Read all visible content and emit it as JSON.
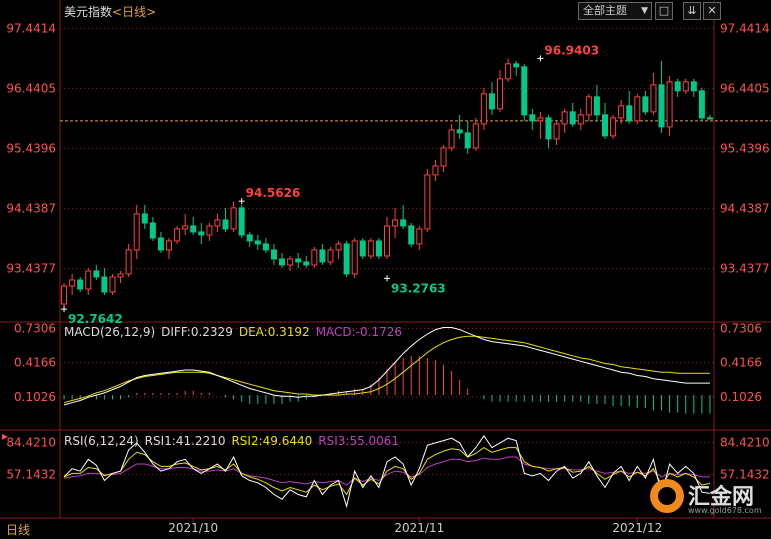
{
  "header": {
    "title": "美元指数",
    "timeframe": "<日线>",
    "dropdown_label": "全部主题",
    "btn_full": "□",
    "btn_down": "⇊",
    "btn_close": "✕"
  },
  "period_label": "日线",
  "logo": {
    "name": "汇金网",
    "url": "www.gold678.com"
  },
  "colors": {
    "up": "#ff4040",
    "down": "#00c98a",
    "grid": "#8b1a1a",
    "ref": "#e8a33a",
    "dif": "#ffffff",
    "dea": "#e8e000",
    "macd": "#c040c0",
    "axis_text": "#ff5050"
  },
  "chart_data": [
    {
      "type": "candlestick",
      "title": "美元指数",
      "y_ticks": [
        97.4414,
        96.4405,
        95.4396,
        94.4387,
        93.4377
      ],
      "ylim": [
        92.55,
        97.58
      ],
      "reference_price": 95.9,
      "x_ticks": [
        {
          "label": "2021/10",
          "index": 16
        },
        {
          "label": "2021/11",
          "index": 44
        },
        {
          "label": "2021/12",
          "index": 71
        }
      ],
      "annotations": [
        {
          "text": "96.9403",
          "index": 59,
          "value": 96.9403,
          "color": "up"
        },
        {
          "text": "94.5626",
          "index": 22,
          "value": 94.5626,
          "color": "up"
        },
        {
          "text": "93.2763",
          "index": 40,
          "value": 93.2763,
          "color": "down"
        },
        {
          "text": "92.7642",
          "index": 0,
          "value": 92.7642,
          "color": "down"
        }
      ],
      "ohlc": [
        [
          92.85,
          93.2,
          92.76,
          93.15
        ],
        [
          93.15,
          93.35,
          93.0,
          93.25
        ],
        [
          93.25,
          93.3,
          93.05,
          93.1
        ],
        [
          93.1,
          93.45,
          93.0,
          93.4
        ],
        [
          93.4,
          93.5,
          93.25,
          93.3
        ],
        [
          93.3,
          93.45,
          93.0,
          93.05
        ],
        [
          93.05,
          93.35,
          93.0,
          93.3
        ],
        [
          93.3,
          93.4,
          93.2,
          93.35
        ],
        [
          93.35,
          93.85,
          93.3,
          93.75
        ],
        [
          93.75,
          94.5,
          93.6,
          94.35
        ],
        [
          94.35,
          94.5,
          94.1,
          94.2
        ],
        [
          94.2,
          94.3,
          93.9,
          93.95
        ],
        [
          93.95,
          94.05,
          93.7,
          93.75
        ],
        [
          93.75,
          93.95,
          93.6,
          93.9
        ],
        [
          93.9,
          94.15,
          93.85,
          94.1
        ],
        [
          94.1,
          94.35,
          94.0,
          94.15
        ],
        [
          94.15,
          94.3,
          94.0,
          94.05
        ],
        [
          94.05,
          94.2,
          93.85,
          94.0
        ],
        [
          94.0,
          94.2,
          93.9,
          94.15
        ],
        [
          94.15,
          94.35,
          94.05,
          94.25
        ],
        [
          94.25,
          94.45,
          94.05,
          94.1
        ],
        [
          94.1,
          94.56,
          94.05,
          94.45
        ],
        [
          94.45,
          94.5,
          93.95,
          94.0
        ],
        [
          94.0,
          94.05,
          93.8,
          93.9
        ],
        [
          93.9,
          94.0,
          93.75,
          93.85
        ],
        [
          93.85,
          93.95,
          93.7,
          93.75
        ],
        [
          93.75,
          93.85,
          93.5,
          93.6
        ],
        [
          93.6,
          93.7,
          93.45,
          93.5
        ],
        [
          93.5,
          93.65,
          93.4,
          93.6
        ],
        [
          93.6,
          93.7,
          93.45,
          93.55
        ],
        [
          93.55,
          93.65,
          93.45,
          93.5
        ],
        [
          93.5,
          93.8,
          93.45,
          93.75
        ],
        [
          93.75,
          93.85,
          93.5,
          93.55
        ],
        [
          93.55,
          93.8,
          93.5,
          93.75
        ],
        [
          93.75,
          93.9,
          93.6,
          93.85
        ],
        [
          93.85,
          93.9,
          93.3,
          93.35
        ],
        [
          93.35,
          93.95,
          93.28,
          93.9
        ],
        [
          93.9,
          93.95,
          93.6,
          93.65
        ],
        [
          93.65,
          93.95,
          93.6,
          93.9
        ],
        [
          93.9,
          93.95,
          93.6,
          93.65
        ],
        [
          93.65,
          94.3,
          93.6,
          94.15
        ],
        [
          94.15,
          94.45,
          93.95,
          94.25
        ],
        [
          94.25,
          94.5,
          94.1,
          94.15
        ],
        [
          94.15,
          94.2,
          93.8,
          93.85
        ],
        [
          93.85,
          94.15,
          93.75,
          94.1
        ],
        [
          94.1,
          95.1,
          94.05,
          95.0
        ],
        [
          95.0,
          95.25,
          94.9,
          95.15
        ],
        [
          95.15,
          95.5,
          95.05,
          95.45
        ],
        [
          95.45,
          95.85,
          95.4,
          95.75
        ],
        [
          95.75,
          96.0,
          95.6,
          95.7
        ],
        [
          95.7,
          95.9,
          95.35,
          95.45
        ],
        [
          95.45,
          95.95,
          95.4,
          95.85
        ],
        [
          95.85,
          96.45,
          95.75,
          96.35
        ],
        [
          96.35,
          96.55,
          96.0,
          96.1
        ],
        [
          96.1,
          96.75,
          96.05,
          96.6
        ],
        [
          96.6,
          96.94,
          96.55,
          96.85
        ],
        [
          96.85,
          96.9,
          96.65,
          96.8
        ],
        [
          96.8,
          96.85,
          95.9,
          96.0
        ],
        [
          96.0,
          96.1,
          95.75,
          95.9
        ],
        [
          95.9,
          96.05,
          95.6,
          95.95
        ],
        [
          95.95,
          96.0,
          95.45,
          95.6
        ],
        [
          95.6,
          95.9,
          95.5,
          95.85
        ],
        [
          95.85,
          96.1,
          95.7,
          96.05
        ],
        [
          96.05,
          96.2,
          95.8,
          95.85
        ],
        [
          95.85,
          96.1,
          95.75,
          96.0
        ],
        [
          96.0,
          96.35,
          95.9,
          96.3
        ],
        [
          96.3,
          96.5,
          95.9,
          96.0
        ],
        [
          96.0,
          96.2,
          95.6,
          95.65
        ],
        [
          95.65,
          96.0,
          95.6,
          95.95
        ],
        [
          95.95,
          96.25,
          95.85,
          96.15
        ],
        [
          96.15,
          96.4,
          95.85,
          95.9
        ],
        [
          95.9,
          96.35,
          95.85,
          96.3
        ],
        [
          96.3,
          96.4,
          96.0,
          96.05
        ],
        [
          96.05,
          96.7,
          96.0,
          96.5
        ],
        [
          96.5,
          96.9,
          95.7,
          95.8
        ],
        [
          95.8,
          96.65,
          95.65,
          96.55
        ],
        [
          96.55,
          96.6,
          96.3,
          96.4
        ],
        [
          96.4,
          96.6,
          96.35,
          96.55
        ],
        [
          96.55,
          96.6,
          96.3,
          96.4
        ],
        [
          96.4,
          96.45,
          95.9,
          95.95
        ],
        [
          95.95,
          96.0,
          95.92,
          95.93
        ]
      ]
    },
    {
      "type": "line",
      "title": "MACD",
      "legend": [
        "MACD(26,12,9)",
        "DIFF:0.2329",
        "DEA:0.3192",
        "MACD:-0.1726"
      ],
      "y_ticks": [
        0.7306,
        0.4166,
        0.1026
      ],
      "ylim": [
        -0.2,
        0.79
      ],
      "baseline": 0.12,
      "series": [
        {
          "name": "DIFF",
          "values": [
            0.03,
            0.05,
            0.07,
            0.1,
            0.12,
            0.14,
            0.17,
            0.2,
            0.24,
            0.28,
            0.3,
            0.31,
            0.32,
            0.33,
            0.34,
            0.35,
            0.35,
            0.34,
            0.33,
            0.3,
            0.27,
            0.24,
            0.21,
            0.18,
            0.16,
            0.14,
            0.12,
            0.11,
            0.11,
            0.1,
            0.11,
            0.11,
            0.12,
            0.13,
            0.14,
            0.15,
            0.16,
            0.17,
            0.2,
            0.26,
            0.34,
            0.42,
            0.5,
            0.57,
            0.63,
            0.68,
            0.72,
            0.74,
            0.74,
            0.72,
            0.69,
            0.66,
            0.63,
            0.61,
            0.6,
            0.59,
            0.58,
            0.57,
            0.55,
            0.53,
            0.51,
            0.49,
            0.47,
            0.45,
            0.43,
            0.41,
            0.39,
            0.37,
            0.35,
            0.33,
            0.32,
            0.3,
            0.29,
            0.27,
            0.26,
            0.25,
            0.24,
            0.23,
            0.23,
            0.23,
            0.23
          ]
        },
        {
          "name": "DEA",
          "values": [
            0.05,
            0.07,
            0.09,
            0.11,
            0.14,
            0.16,
            0.19,
            0.22,
            0.25,
            0.27,
            0.29,
            0.3,
            0.31,
            0.32,
            0.33,
            0.33,
            0.33,
            0.33,
            0.32,
            0.3,
            0.28,
            0.26,
            0.24,
            0.22,
            0.2,
            0.18,
            0.16,
            0.15,
            0.14,
            0.13,
            0.13,
            0.12,
            0.12,
            0.12,
            0.12,
            0.13,
            0.13,
            0.14,
            0.15,
            0.18,
            0.22,
            0.27,
            0.33,
            0.39,
            0.45,
            0.51,
            0.56,
            0.6,
            0.63,
            0.65,
            0.66,
            0.66,
            0.65,
            0.64,
            0.63,
            0.62,
            0.61,
            0.6,
            0.58,
            0.56,
            0.54,
            0.52,
            0.5,
            0.48,
            0.46,
            0.45,
            0.43,
            0.41,
            0.4,
            0.38,
            0.37,
            0.36,
            0.35,
            0.34,
            0.33,
            0.33,
            0.32,
            0.32,
            0.32,
            0.32,
            0.32
          ]
        },
        {
          "name": "MACD",
          "values": [
            -0.04,
            -0.04,
            -0.04,
            -0.02,
            -0.04,
            -0.04,
            -0.04,
            -0.04,
            -0.02,
            0.02,
            0.02,
            0.02,
            0.02,
            0.02,
            0.02,
            0.04,
            0.04,
            0.02,
            0.02,
            0.0,
            -0.02,
            -0.04,
            -0.06,
            -0.08,
            -0.08,
            -0.08,
            -0.08,
            -0.08,
            -0.06,
            -0.06,
            -0.04,
            -0.02,
            0.0,
            0.02,
            0.04,
            0.04,
            0.06,
            0.06,
            0.1,
            0.16,
            0.24,
            0.3,
            0.34,
            0.36,
            0.36,
            0.34,
            0.32,
            0.28,
            0.22,
            0.14,
            0.06,
            0.0,
            -0.04,
            -0.06,
            -0.06,
            -0.06,
            -0.06,
            -0.06,
            -0.06,
            -0.06,
            -0.06,
            -0.06,
            -0.06,
            -0.06,
            -0.06,
            -0.08,
            -0.08,
            -0.08,
            -0.1,
            -0.1,
            -0.1,
            -0.12,
            -0.12,
            -0.14,
            -0.14,
            -0.16,
            -0.16,
            -0.17,
            -0.17,
            -0.17,
            -0.17
          ]
        }
      ]
    },
    {
      "type": "line",
      "title": "RSI",
      "legend": [
        "RSI(6,12,24)",
        "RSI1:41.2210",
        "RSI2:49.6440",
        "RSI3:55.0061"
      ],
      "y_ticks": [
        84.421,
        57.1432
      ],
      "ylim": [
        20,
        95
      ],
      "series": [
        {
          "name": "RSI1",
          "values": [
            55,
            62,
            60,
            70,
            65,
            52,
            58,
            60,
            78,
            84,
            76,
            66,
            60,
            62,
            68,
            70,
            62,
            58,
            62,
            66,
            60,
            72,
            56,
            52,
            50,
            46,
            40,
            36,
            44,
            40,
            38,
            52,
            40,
            48,
            52,
            30,
            60,
            46,
            56,
            46,
            68,
            72,
            66,
            48,
            62,
            82,
            84,
            86,
            88,
            84,
            72,
            80,
            90,
            80,
            84,
            88,
            86,
            58,
            56,
            58,
            52,
            60,
            64,
            54,
            58,
            68,
            56,
            46,
            58,
            64,
            52,
            64,
            54,
            70,
            40,
            66,
            58,
            64,
            58,
            42,
            41
          ]
        },
        {
          "name": "RSI2",
          "values": [
            55,
            58,
            58,
            63,
            62,
            56,
            58,
            60,
            70,
            76,
            74,
            68,
            64,
            64,
            66,
            67,
            64,
            61,
            62,
            64,
            61,
            66,
            58,
            55,
            53,
            50,
            46,
            43,
            46,
            44,
            42,
            48,
            44,
            47,
            49,
            40,
            54,
            48,
            53,
            49,
            60,
            64,
            62,
            53,
            58,
            70,
            74,
            77,
            79,
            78,
            72,
            75,
            80,
            76,
            78,
            80,
            80,
            68,
            64,
            63,
            60,
            62,
            63,
            59,
            60,
            64,
            58,
            53,
            57,
            60,
            55,
            59,
            56,
            62,
            48,
            58,
            55,
            58,
            55,
            48,
            49.6
          ]
        },
        {
          "name": "RSI3",
          "values": [
            54,
            55,
            56,
            58,
            58,
            57,
            57,
            58,
            62,
            66,
            66,
            64,
            62,
            62,
            63,
            63,
            62,
            60,
            60,
            61,
            60,
            62,
            58,
            56,
            55,
            54,
            52,
            50,
            51,
            50,
            49,
            51,
            50,
            51,
            52,
            48,
            54,
            51,
            54,
            52,
            57,
            60,
            59,
            55,
            57,
            63,
            66,
            68,
            70,
            70,
            68,
            69,
            71,
            70,
            70,
            72,
            72,
            66,
            64,
            63,
            62,
            62,
            62,
            61,
            61,
            62,
            60,
            58,
            59,
            60,
            58,
            59,
            58,
            60,
            55,
            58,
            57,
            58,
            57,
            55,
            55.0
          ]
        }
      ]
    }
  ]
}
